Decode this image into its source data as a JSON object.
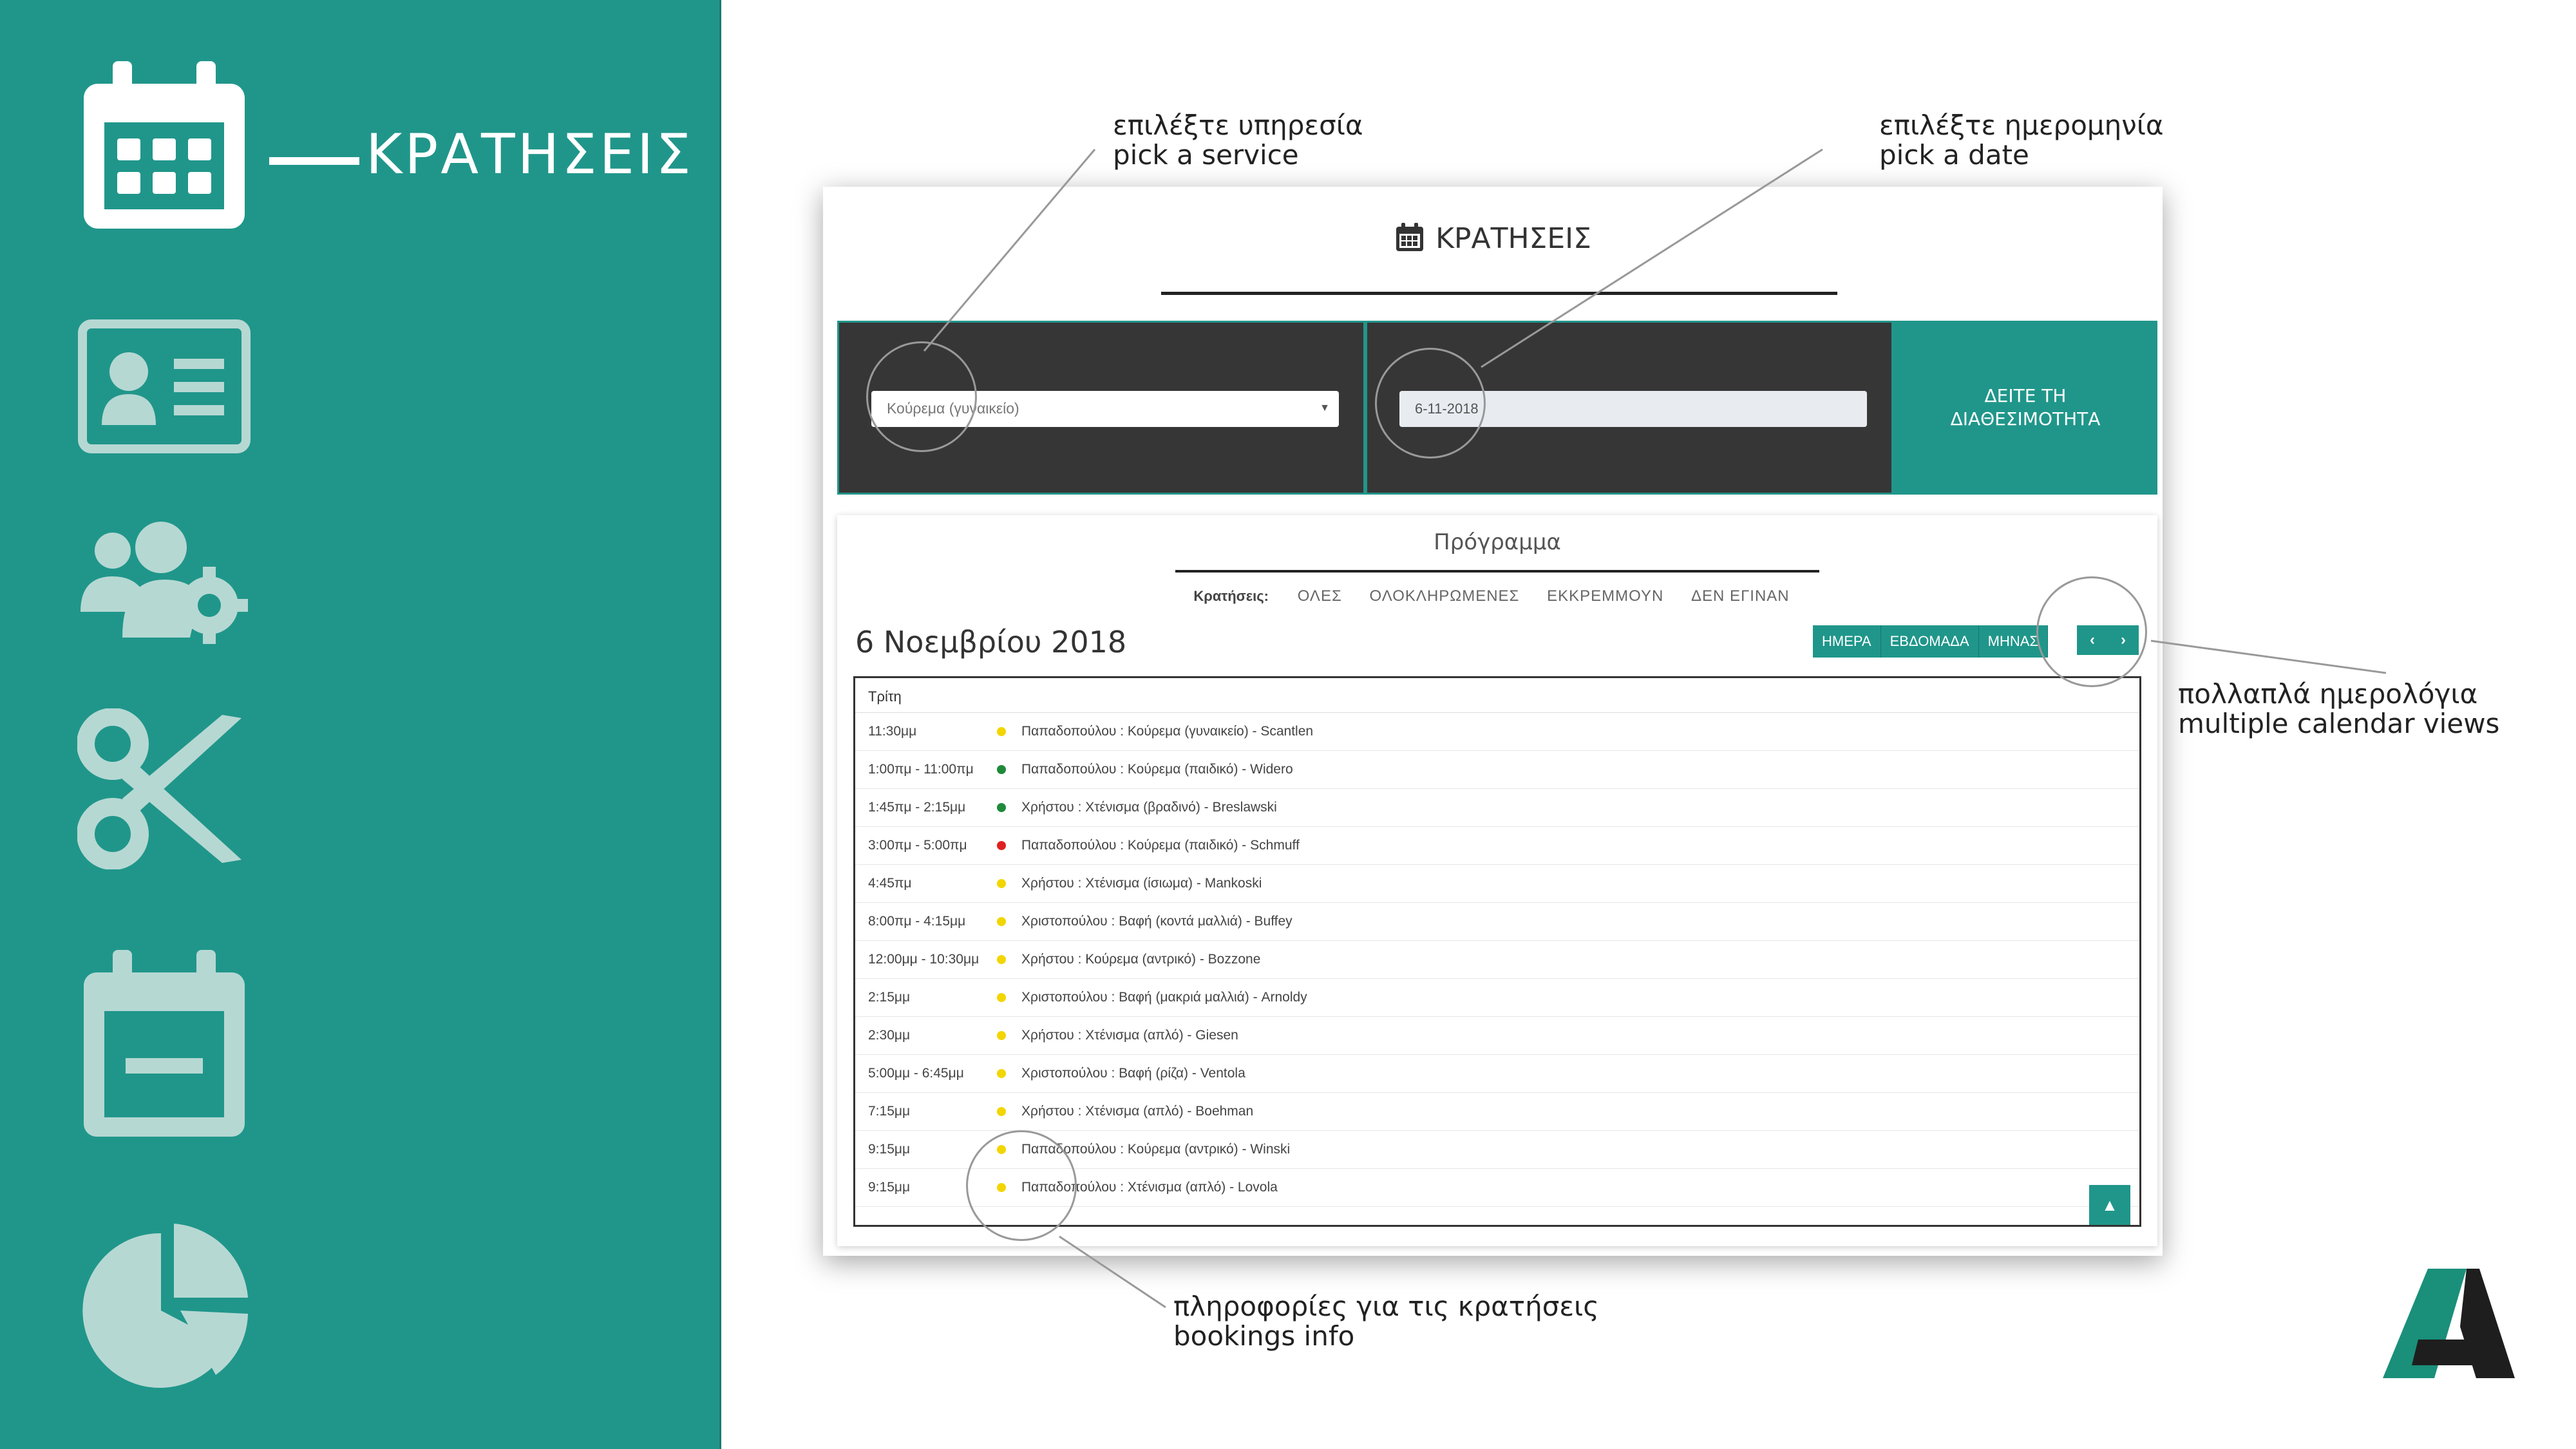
{
  "sidebar": {
    "active_label": "ΚΡΑΤΗΣΕΙΣ",
    "icons": [
      "calendar-icon",
      "contact-card-icon",
      "users-gear-icon",
      "scissors-icon",
      "calendar-minus-icon",
      "pie-chart-icon"
    ]
  },
  "app": {
    "title": "ΚΡΑΤΗΣΕΙΣ",
    "service_select": "Κούρεμα (γυναικείο)",
    "date_value": "6-11-2018",
    "availability_button": [
      "ΔΕΙΤΕ ΤΗ",
      "ΔΙΑΘΕΣΙΜΟΤΗΤΑ"
    ],
    "schedule": {
      "title": "Πρόγραμμα",
      "filter_label": "Κρατήσεις:",
      "filters": [
        "ΟΛΕΣ",
        "ΟΛΟΚΛΗΡΩΜΕΝΕΣ",
        "ΕΚΚΡΕΜΜΟΥΝ",
        "ΔΕΝ ΕΓΙΝΑΝ"
      ],
      "date_heading": "6 Νοεμβρίου 2018",
      "views": [
        "ΗΜΕΡΑ",
        "ΕΒΔΟΜΑΔΑ",
        "ΜΗΝΑΣ"
      ],
      "nav": [
        "‹",
        "›"
      ],
      "day": "Τρίτη",
      "bookings": [
        {
          "time": "11:30μμ",
          "status_color": "#f2d600",
          "desc": "Παπαδοπούλου : Κούρεμα (γυναικείο) - Scantlen"
        },
        {
          "time": "1:00πμ - 11:00πμ",
          "status_color": "#1f8a3a",
          "desc": "Παπαδοπούλου : Κούρεμα (παιδικό) - Widero"
        },
        {
          "time": "1:45πμ - 2:15μμ",
          "status_color": "#1f8a3a",
          "desc": "Χρήστου : Χτένισμα (βραδινό) - Breslawski"
        },
        {
          "time": "3:00πμ - 5:00πμ",
          "status_color": "#e02020",
          "desc": "Παπαδοπούλου : Κούρεμα (παιδικό) - Schmuff"
        },
        {
          "time": "4:45πμ",
          "status_color": "#f2d600",
          "desc": "Χρήστου : Χτένισμα (ίσιωμα) - Mankoski"
        },
        {
          "time": "8:00πμ - 4:15μμ",
          "status_color": "#f2d600",
          "desc": "Χριστοπούλου : Βαφή (κοντά μαλλιά) - Buffey"
        },
        {
          "time": "12:00μμ - 10:30μμ",
          "status_color": "#f2d600",
          "desc": "Χρήστου : Κούρεμα (αντρικό) - Bozzone"
        },
        {
          "time": "2:15μμ",
          "status_color": "#f2d600",
          "desc": "Χριστοπούλου : Βαφή (μακριά μαλλιά) - Arnoldy"
        },
        {
          "time": "2:30μμ",
          "status_color": "#f2d600",
          "desc": "Χρήστου : Χτένισμα (απλό) - Giesen"
        },
        {
          "time": "5:00μμ - 6:45μμ",
          "status_color": "#f2d600",
          "desc": "Χριστοπούλου : Βαφή (ρίζα) - Ventola"
        },
        {
          "time": "7:15μμ",
          "status_color": "#f2d600",
          "desc": "Χρήστου : Χτένισμα (απλό) - Boehman"
        },
        {
          "time": "9:15μμ",
          "status_color": "#f2d600",
          "desc": "Παπαδοπούλου : Κούρεμα (αντρικό) - Winski"
        },
        {
          "time": "9:15μμ",
          "status_color": "#f2d600",
          "desc": "Παπαδοπούλου : Χτένισμα (απλό) - Lovola"
        }
      ]
    }
  },
  "annotations": {
    "service": [
      "επιλέξτε υπηρεσία",
      "pick a service"
    ],
    "date": [
      "επιλέξτε ημερομηνία",
      "pick a date"
    ],
    "views": [
      "πολλαπλά ημερολόγια",
      "multiple calendar views"
    ],
    "bookings": [
      "πληροφορίες για τις κρατήσεις",
      "bookings info"
    ]
  },
  "colors": {
    "brand_teal": "#20968a",
    "dark_panel": "#363636",
    "logo_teal": "#1a8f7a",
    "logo_dark": "#1e1e1e"
  }
}
